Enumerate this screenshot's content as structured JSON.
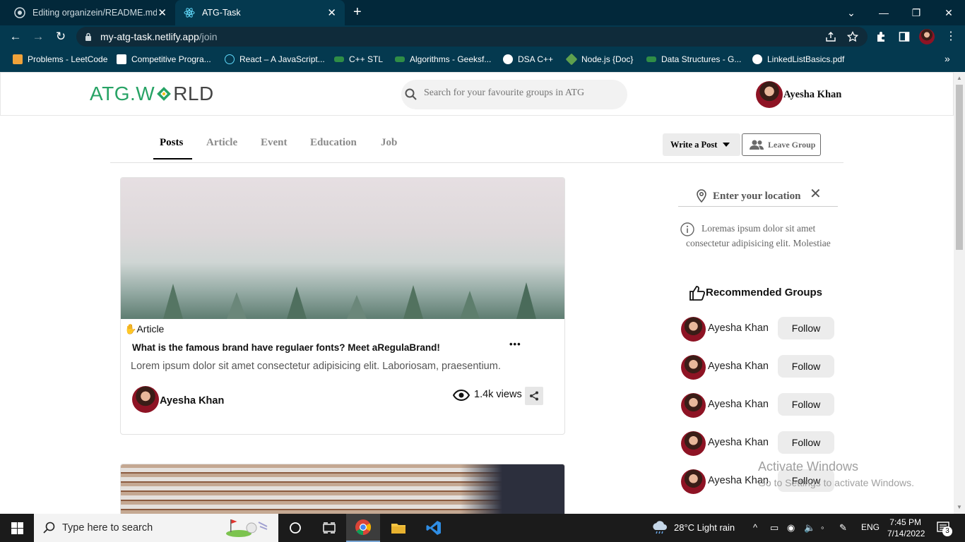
{
  "browser": {
    "tabs": [
      {
        "title": "Editing organizein/README.md a",
        "active": false
      },
      {
        "title": "ATG-Task",
        "active": true
      }
    ],
    "url_host": "my-atg-task.netlify.app",
    "url_path": "/join",
    "bookmarks": [
      {
        "label": "Problems - LeetCode",
        "icon": "leetcode-icon"
      },
      {
        "label": "Competitive Progra...",
        "icon": "cc-icon"
      },
      {
        "label": "React – A JavaScript...",
        "icon": "react-icon"
      },
      {
        "label": "C++ STL",
        "icon": "gfg-icon"
      },
      {
        "label": "Algorithms - Geeksf...",
        "icon": "gfg-icon"
      },
      {
        "label": "DSA C++",
        "icon": "globe-icon"
      },
      {
        "label": "Node.js {Doc}",
        "icon": "node-icon"
      },
      {
        "label": "Data Structures - G...",
        "icon": "gfg-icon"
      },
      {
        "label": "LinkedListBasics.pdf",
        "icon": "globe-icon"
      }
    ]
  },
  "header": {
    "logo_left": "ATG.W",
    "logo_right": "RLD",
    "search_placeholder": "Search for your favourite groups in ATG",
    "user_name": "Ayesha Khan"
  },
  "nav": {
    "tabs": [
      "Posts",
      "Article",
      "Event",
      "Education",
      "Job"
    ],
    "active_tab": "Posts",
    "write_post": "Write a Post",
    "leave_group": "Leave Group"
  },
  "post": {
    "category_emoji": "✋",
    "category": "Article",
    "title": "What is the famous brand have regulaer fonts? Meet aRegulaBrand!",
    "body": "Lorem ipsum dolor sit amet consectetur adipisicing elit. Laboriosam, praesentium.",
    "author": "Ayesha Khan",
    "views": "1.4k views",
    "more": "•••"
  },
  "sidebar": {
    "location_placeholder": "Enter your location",
    "info_text_line1": "Loremas ipsum dolor sit amet",
    "info_text_line2": "consectetur adipisicing elit. Molestiae",
    "recommended_title": "Recommended Groups",
    "groups": [
      {
        "name": "Ayesha Khan",
        "action": "Follow"
      },
      {
        "name": "Ayesha Khan",
        "action": "Follow"
      },
      {
        "name": "Ayesha Khan",
        "action": "Follow"
      },
      {
        "name": "Ayesha Khan",
        "action": "Follow"
      },
      {
        "name": "Ayesha Khan",
        "action": "Follow"
      }
    ]
  },
  "watermark": {
    "line1": "Activate Windows",
    "line2": "Go to Settings to activate Windows."
  },
  "taskbar": {
    "search_text": "Type here to search",
    "weather": "28°C  Light rain",
    "language": "ENG",
    "time": "7:45 PM",
    "date": "7/14/2022",
    "notifications": "3"
  },
  "colors": {
    "chrome_frame": "#02283a",
    "chrome_toolbar": "#04394f",
    "logo_green": "#27a365",
    "taskbar": "#1b1b1b"
  }
}
